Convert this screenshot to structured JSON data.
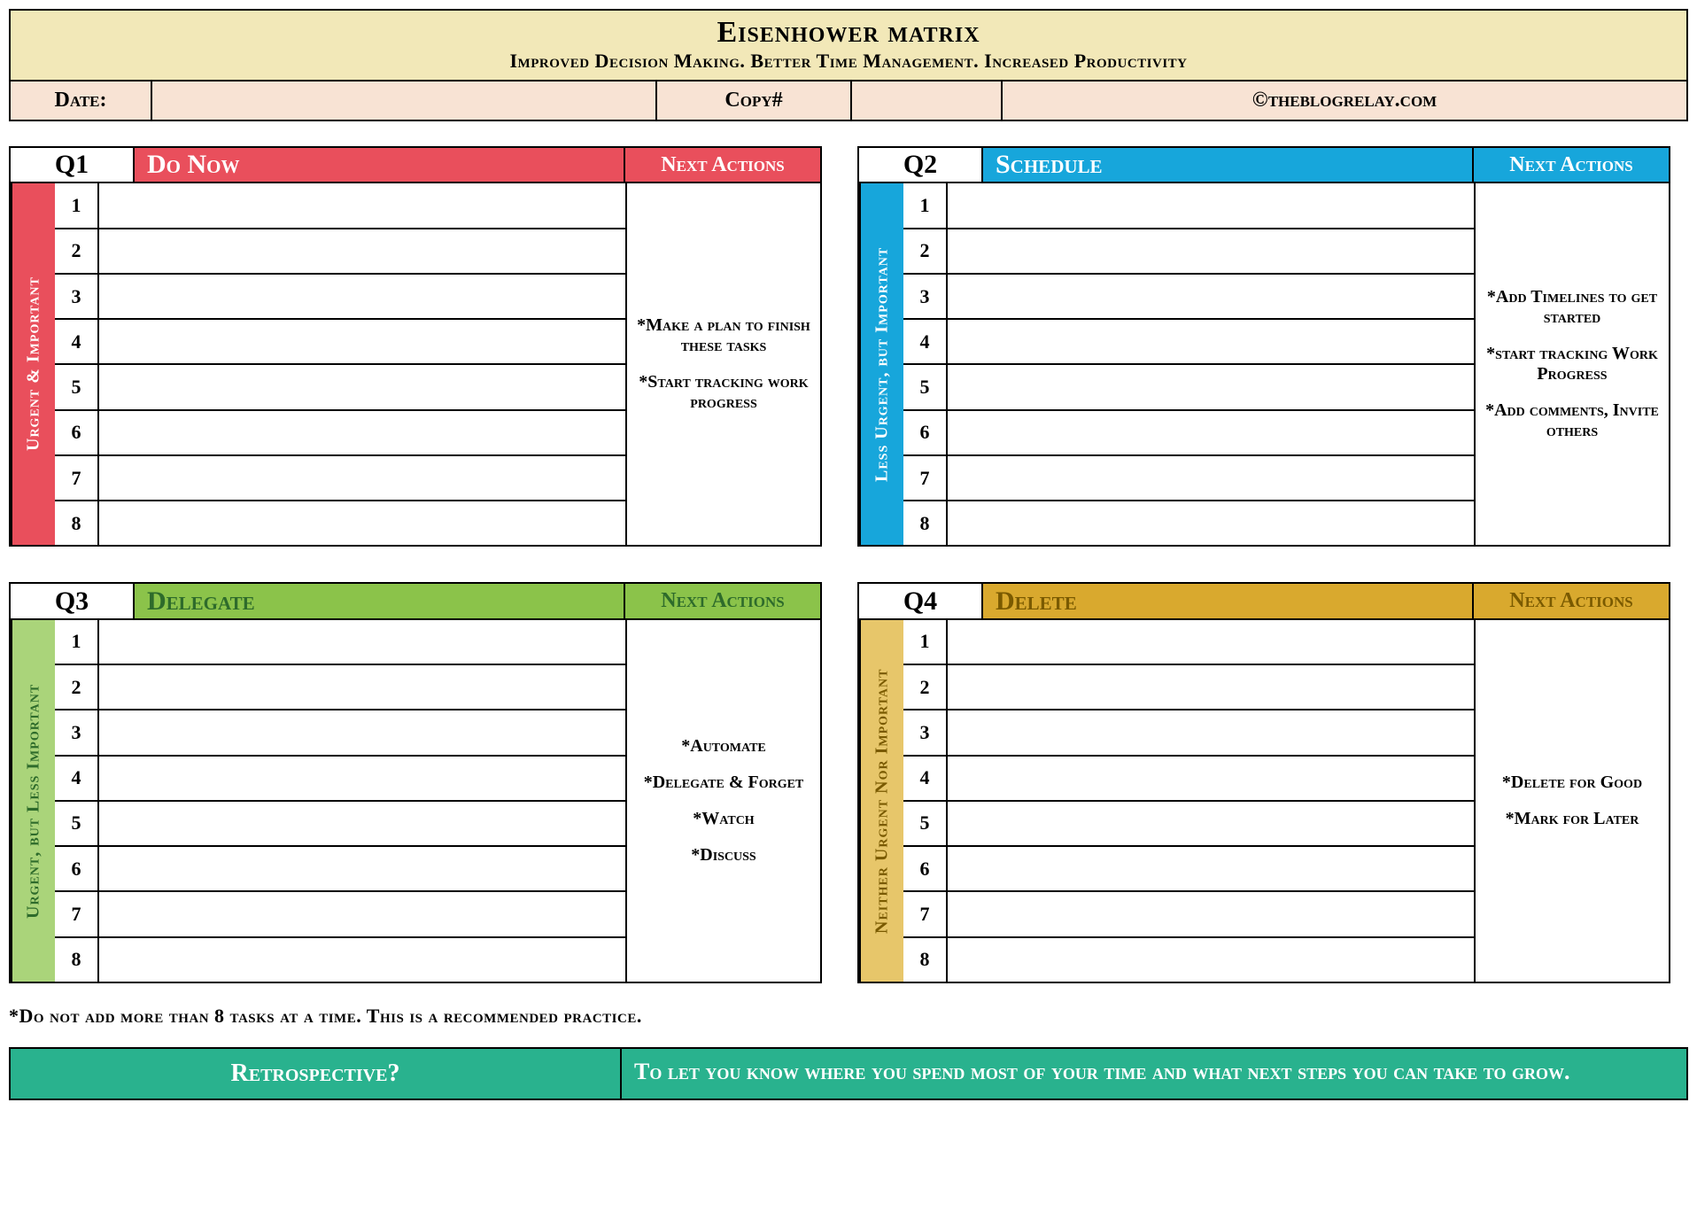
{
  "header": {
    "title": "Eisenhower matrix",
    "subtitle": "Improved Decision Making. Better Time Management. Increased Productivity",
    "date_label": "Date:",
    "date_value": "",
    "copy_label": "Copy#",
    "copy_value": "",
    "credit": "©theblogrelay.com"
  },
  "quadrants": [
    {
      "code": "Q1",
      "title": "Do Now",
      "next_label": "Next Actions",
      "side_label": "Urgent & Important",
      "color_class": "c-red",
      "side_class": "c-red",
      "title_text_class": "",
      "actions": [
        "*Make a plan to finish these tasks",
        "*Start tracking work progress"
      ],
      "rows": [
        "",
        "",
        "",
        "",
        "",
        "",
        "",
        ""
      ]
    },
    {
      "code": "Q2",
      "title": "Schedule",
      "next_label": "Next Actions",
      "side_label": "Less Urgent, but Important",
      "color_class": "c-blue",
      "side_class": "c-blue",
      "title_text_class": "",
      "actions": [
        "*Add Timelines to get started",
        "*start tracking Work Progress",
        "*Add comments, Invite others"
      ],
      "rows": [
        "",
        "",
        "",
        "",
        "",
        "",
        "",
        ""
      ]
    },
    {
      "code": "Q3",
      "title": "Delegate",
      "next_label": "Next Actions",
      "side_label": "Urgent, but Less Important",
      "color_class": "c-green",
      "side_class": "c-green-light",
      "title_text_class": "t-green",
      "actions": [
        "*Automate",
        "*Delegate & Forget",
        "*Watch",
        "*Discuss"
      ],
      "rows": [
        "",
        "",
        "",
        "",
        "",
        "",
        "",
        ""
      ]
    },
    {
      "code": "Q4",
      "title": "Delete",
      "next_label": "Next Actions",
      "side_label": "Neither Urgent Nor Important",
      "color_class": "c-gold",
      "side_class": "c-gold-light",
      "title_text_class": "t-gold",
      "actions": [
        "*Delete for Good",
        "*Mark for Later"
      ],
      "rows": [
        "",
        "",
        "",
        "",
        "",
        "",
        "",
        ""
      ]
    }
  ],
  "footnote": "*Do not add more than 8 tasks at a time. This is a recommended practice.",
  "retro": {
    "label": "Retrospective?",
    "text": "To let you know where you spend most of your time and what next steps you can take to grow."
  }
}
